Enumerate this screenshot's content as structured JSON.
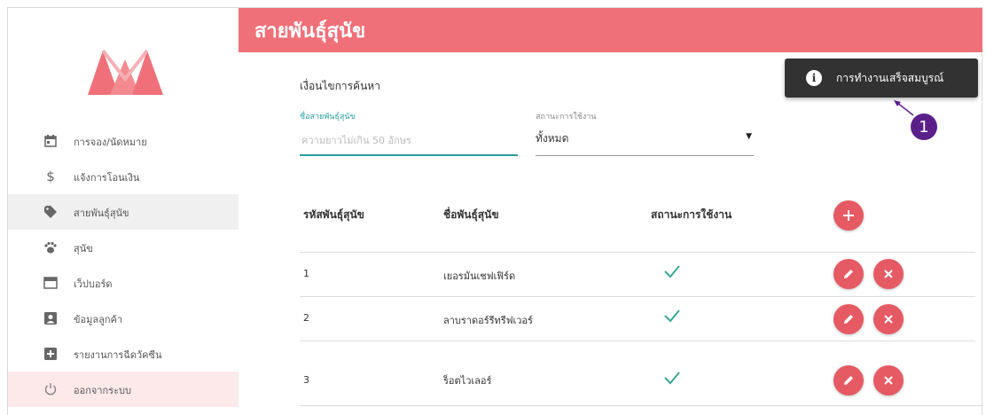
{
  "header": {
    "title": "สายพันธุ์สุนัข"
  },
  "sidebar": {
    "items": [
      {
        "label": "การจอง/นัดหมาย",
        "icon": "calendar-icon"
      },
      {
        "label": "แจ้งการโอนเงิน",
        "icon": "dollar-icon"
      },
      {
        "label": "สายพันธุ์สุนัข",
        "icon": "tag-icon",
        "active": true
      },
      {
        "label": "สุนัข",
        "icon": "paw-icon"
      },
      {
        "label": "เว็ปบอร์ด",
        "icon": "board-icon"
      },
      {
        "label": "ข้อมูลลูกค้า",
        "icon": "account-box-icon"
      },
      {
        "label": "รายงานการฉีดวัคซีน",
        "icon": "medical-plus-icon"
      },
      {
        "label": "ออกจากระบบ",
        "icon": "power-icon"
      }
    ]
  },
  "filter": {
    "title": "เงื่อนไขการค้นหา",
    "name_label": "ชื่อสายพันธุ์สุนัข",
    "name_placeholder": "ความยาวไม่เกิน 50 อักษร",
    "name_value": "",
    "status_label": "สถานะการใช้งาน",
    "status_value": "ทั้งหมด"
  },
  "table": {
    "headers": {
      "code": "รหัสพันธุ์สุนัข",
      "name": "ชื่อพันธุ์สุนัข",
      "status": "สถานะการใช้งาน"
    },
    "rows": [
      {
        "code": "1",
        "name": "เยอรมันเชฟเฟิร์ด",
        "active": true
      },
      {
        "code": "2",
        "name": "ลาบราดอร์รีทรีฟเวอร์",
        "active": true
      },
      {
        "code": "3",
        "name": "ร็อตไวเลอร์",
        "active": true
      }
    ]
  },
  "toast": {
    "message": "การทำงานเสร็จสมบูรณ์",
    "icon_glyph": "i"
  },
  "callout": {
    "number": "1"
  },
  "colors": {
    "header": "#f07079",
    "button": "#e65a64",
    "accent": "#2a9d9d",
    "check": "#3aa893",
    "callout": "#5b1f8a",
    "toast": "#323232"
  }
}
